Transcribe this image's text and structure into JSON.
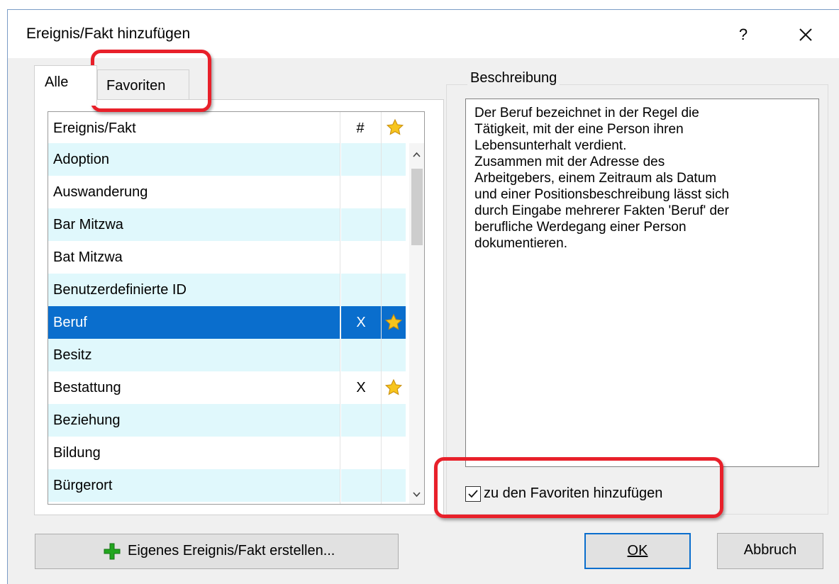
{
  "window": {
    "title": "Ereignis/Fakt hinzufügen",
    "help_label": "?",
    "close_icon": "close-icon"
  },
  "tabs": [
    {
      "label": "Alle",
      "active": true
    },
    {
      "label": "Favoriten",
      "active": false
    }
  ],
  "list": {
    "columns": {
      "name": "Ereignis/Fakt",
      "count": "#",
      "favorite_icon": "star-icon"
    },
    "rows": [
      {
        "name": "Adoption",
        "count": "",
        "favorite": false,
        "selected": false
      },
      {
        "name": "Auswanderung",
        "count": "",
        "favorite": false,
        "selected": false
      },
      {
        "name": "Bar Mitzwa",
        "count": "",
        "favorite": false,
        "selected": false
      },
      {
        "name": "Bat Mitzwa",
        "count": "",
        "favorite": false,
        "selected": false
      },
      {
        "name": "Benutzerdefinierte ID",
        "count": "",
        "favorite": false,
        "selected": false
      },
      {
        "name": "Beruf",
        "count": "X",
        "favorite": true,
        "selected": true
      },
      {
        "name": "Besitz",
        "count": "",
        "favorite": false,
        "selected": false
      },
      {
        "name": "Bestattung",
        "count": "X",
        "favorite": true,
        "selected": false
      },
      {
        "name": "Beziehung",
        "count": "",
        "favorite": false,
        "selected": false
      },
      {
        "name": "Bildung",
        "count": "",
        "favorite": false,
        "selected": false
      },
      {
        "name": "Bürgerort",
        "count": "",
        "favorite": false,
        "selected": false
      }
    ],
    "scroll_position": 0.0
  },
  "description": {
    "legend": "Beschreibung",
    "text": "Der Beruf bezeichnet in der Regel die\nTätigkeit, mit der eine Person ihren\nLebensunterhalt verdient.\nZusammen mit der Adresse des\nArbeitgebers, einem Zeitraum als Datum\nund einer Positionsbeschreibung lässt sich\ndurch Eingabe mehrerer Fakten 'Beruf' der\nberufliche Werdegang einer Person\ndokumentieren."
  },
  "favorite_checkbox": {
    "label": "zu den Favoriten hinzufügen",
    "checked": true
  },
  "buttons": {
    "create": "Eigenes Ereignis/Fakt erstellen...",
    "ok": "OK",
    "cancel": "Abbruch"
  },
  "colors": {
    "selection": "#0a6ecd",
    "alt_row": "#e0f8fc",
    "highlight": "#e8202a",
    "star": "#f7c51e",
    "plus": "#22a61f"
  }
}
